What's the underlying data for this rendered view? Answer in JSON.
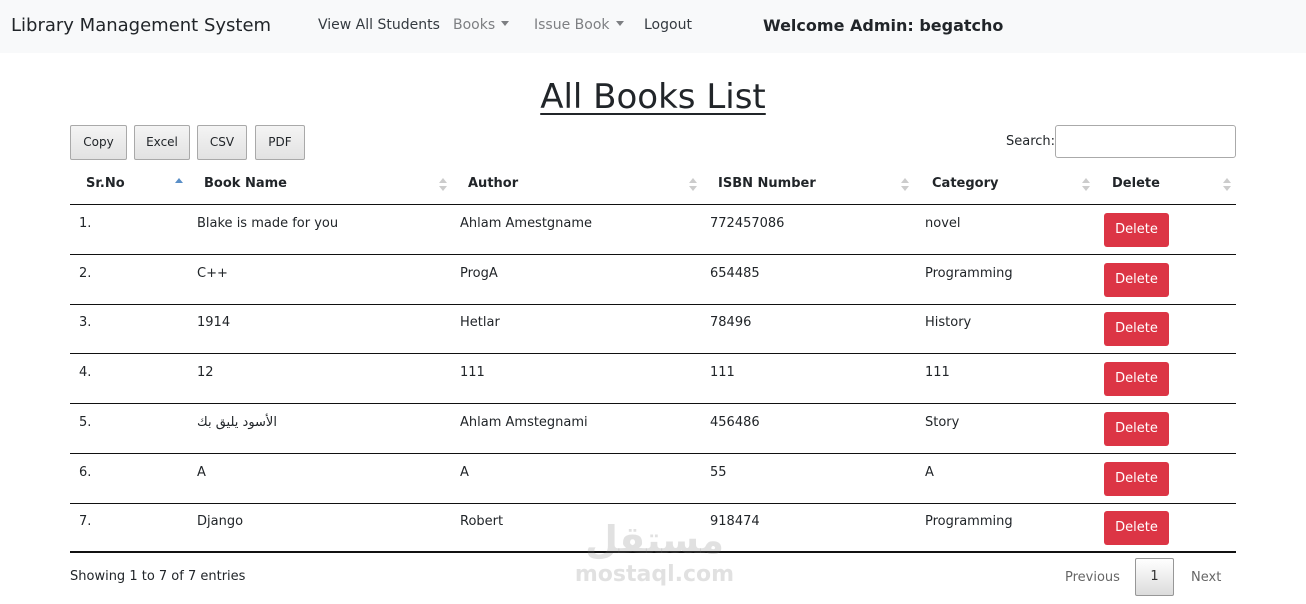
{
  "navbar": {
    "brand": "Library Management System",
    "items": [
      {
        "label": "View All Students"
      },
      {
        "label": "Books"
      },
      {
        "label": "Issue Book"
      },
      {
        "label": "Logout"
      }
    ],
    "welcome": "Welcome Admin: begatcho"
  },
  "page": {
    "title": "All Books List"
  },
  "toolbar": {
    "buttons": [
      "Copy",
      "Excel",
      "CSV",
      "PDF"
    ],
    "search_label": "Search:",
    "search_value": "",
    "search_placeholder": ""
  },
  "table": {
    "columns": [
      "Sr.No",
      "Book Name",
      "Author",
      "ISBN Number",
      "Category",
      "Delete"
    ],
    "sort_column": "Sr.No",
    "sort_direction": "ascending",
    "rows": [
      {
        "sr": "1.",
        "name": "Blake is made for you",
        "author": "Ahlam Amestgname",
        "isbn": "772457086",
        "category": "novel",
        "action": "Delete"
      },
      {
        "sr": "2.",
        "name": "C++",
        "author": "ProgA",
        "isbn": "654485",
        "category": "Programming",
        "action": "Delete"
      },
      {
        "sr": "3.",
        "name": "1914",
        "author": "Hetlar",
        "isbn": "78496",
        "category": "History",
        "action": "Delete"
      },
      {
        "sr": "4.",
        "name": "12",
        "author": "111",
        "isbn": "111",
        "category": "111",
        "action": "Delete"
      },
      {
        "sr": "5.",
        "name": "الأسود يليق بك",
        "author": "Ahlam Amstegnami",
        "isbn": "456486",
        "category": "Story",
        "action": "Delete"
      },
      {
        "sr": "6.",
        "name": "A",
        "author": "A",
        "isbn": "55",
        "category": "A",
        "action": "Delete"
      },
      {
        "sr": "7.",
        "name": "Django",
        "author": "Robert",
        "isbn": "918474",
        "category": "Programming",
        "action": "Delete"
      }
    ]
  },
  "footer": {
    "info": "Showing 1 to 7 of 7 entries",
    "pagination": {
      "previous": "Previous",
      "current": "1",
      "next": "Next"
    }
  },
  "watermark": {
    "arabic": "مستقل",
    "latin": "mostaql.com"
  },
  "colors": {
    "delete": "#dc3545",
    "navbar_bg": "#f8f9fa",
    "sort_active": "#5a8fc7"
  }
}
